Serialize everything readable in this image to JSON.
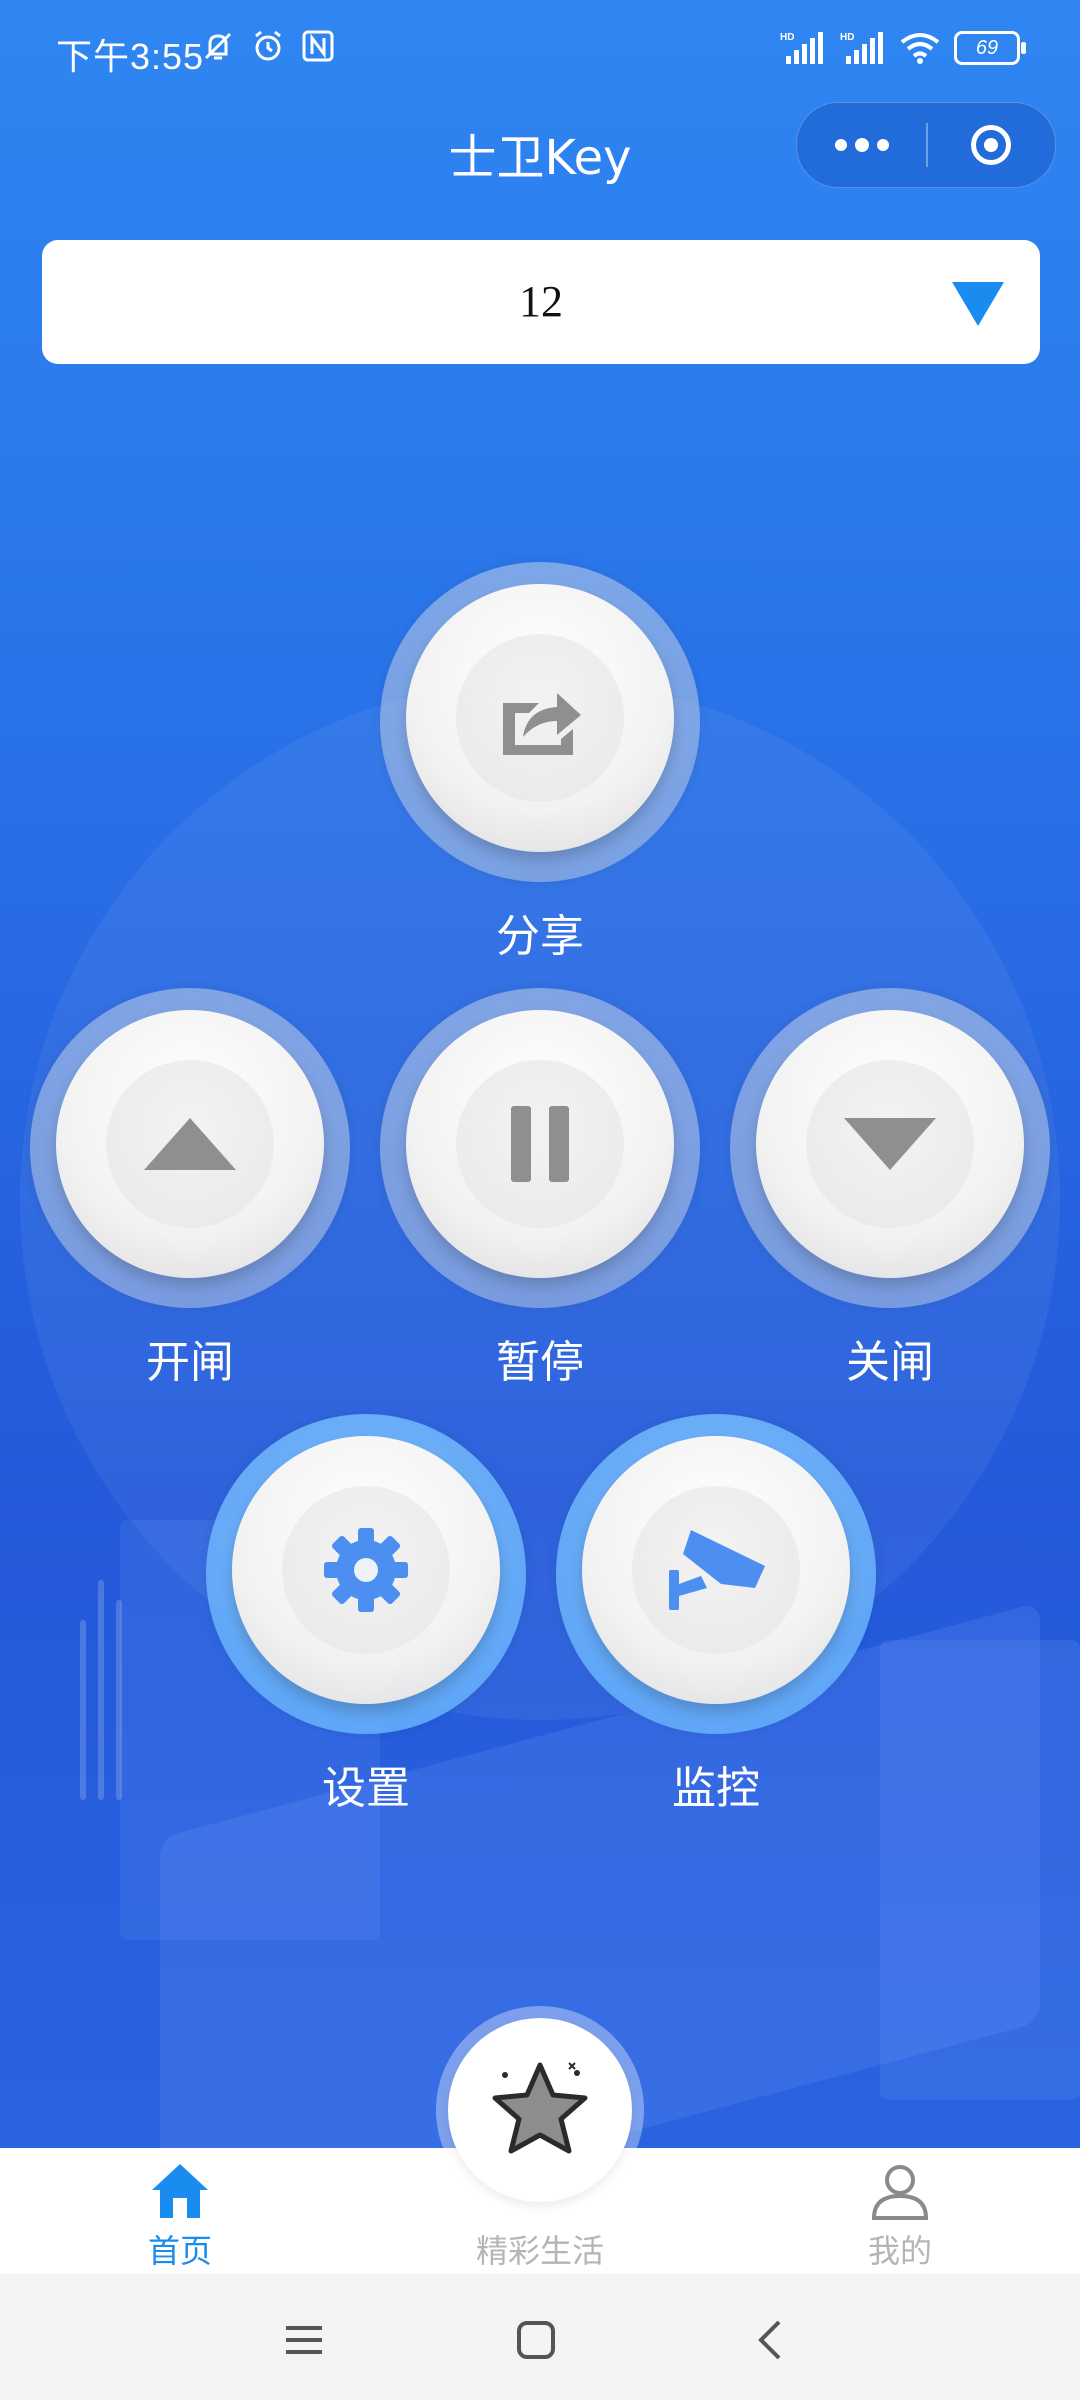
{
  "status_bar": {
    "time": "下午3:55",
    "battery": "69",
    "icons_left": [
      "muted-bell-icon",
      "alarm-icon",
      "nfc-icon"
    ],
    "icons_right": [
      "hd-signal-1-icon",
      "hd-signal-2-icon",
      "wifi-icon",
      "battery-icon"
    ]
  },
  "header": {
    "title": "士卫Key",
    "capsule": [
      "more-dots-icon",
      "close-target-icon"
    ]
  },
  "selector": {
    "value": "12",
    "icon": "dropdown-triangle-icon"
  },
  "actions": {
    "share": {
      "label": "分享",
      "icon": "share-icon"
    },
    "open": {
      "label": "开闸",
      "icon": "up-triangle-icon"
    },
    "pause": {
      "label": "暂停",
      "icon": "pause-icon"
    },
    "close": {
      "label": "关闸",
      "icon": "down-triangle-icon"
    },
    "settings": {
      "label": "设置",
      "icon": "gear-icon"
    },
    "monitor": {
      "label": "监控",
      "icon": "camera-icon"
    }
  },
  "tabbar": {
    "home": {
      "label": "首页",
      "icon": "home-icon",
      "active": true
    },
    "life": {
      "label": "精彩生活",
      "icon": "star-icon",
      "active": false
    },
    "mine": {
      "label": "我的",
      "icon": "user-icon",
      "active": false
    }
  },
  "colors": {
    "accent": "#1a8cf0",
    "tab_active": "#1a8cf0",
    "tab_inactive": "#b5b5b5",
    "button_icon_grey": "#8f8f8f",
    "button_icon_blue": "#4d8ff0"
  },
  "system_nav": [
    "menu-icon",
    "home-square-icon",
    "back-icon"
  ]
}
